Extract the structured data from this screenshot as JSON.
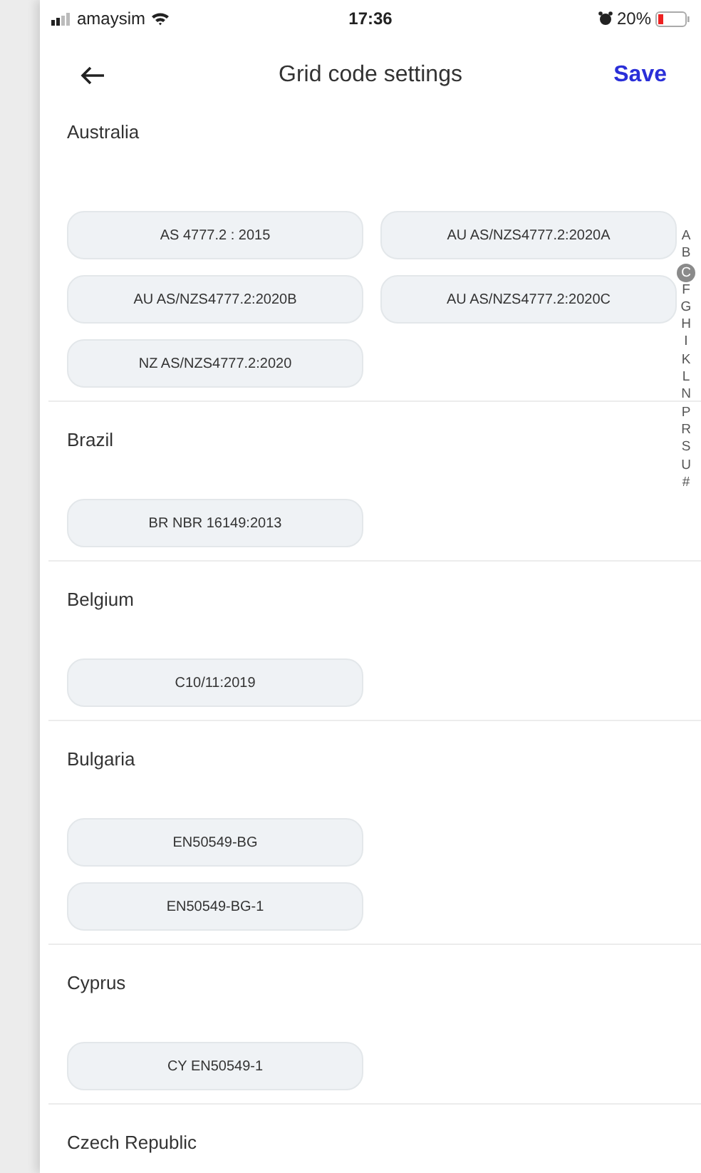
{
  "status_bar": {
    "carrier": "amaysim",
    "time": "17:36",
    "battery": "20%"
  },
  "header": {
    "title": "Grid code settings",
    "action": "Save"
  },
  "sections": [
    {
      "country": "Australia",
      "kind": "grid",
      "codes": [
        "AS 4777.2 : 2015",
        "AU AS/NZS4777.2:2020A",
        "AU AS/NZS4777.2:2020B",
        "AU AS/NZS4777.2:2020C",
        "NZ AS/NZS4777.2:2020"
      ]
    },
    {
      "country": "Brazil",
      "kind": "grid",
      "codes": [
        "BR NBR 16149:2013"
      ]
    },
    {
      "country": "Belgium",
      "kind": "grid",
      "codes": [
        "C10/11:2019"
      ]
    },
    {
      "country": "Bulgaria",
      "kind": "stacked",
      "codes": [
        "EN50549-BG",
        "EN50549-BG-1"
      ]
    },
    {
      "country": "Cyprus",
      "kind": "grid",
      "codes": [
        "CY EN50549-1"
      ]
    },
    {
      "country": "Czech Republic",
      "kind": "grid"
    }
  ],
  "index": [
    {
      "letter": "A",
      "selected": false
    },
    {
      "letter": "B",
      "selected": false
    },
    {
      "letter": "C",
      "selected": true
    },
    {
      "letter": "F",
      "selected": false
    },
    {
      "letter": "G",
      "selected": false
    },
    {
      "letter": "H",
      "selected": false
    },
    {
      "letter": "I",
      "selected": false
    },
    {
      "letter": "K",
      "selected": false
    },
    {
      "letter": "L",
      "selected": false
    },
    {
      "letter": "N",
      "selected": false
    },
    {
      "letter": "P",
      "selected": false
    },
    {
      "letter": "R",
      "selected": false
    },
    {
      "letter": "S",
      "selected": false
    },
    {
      "letter": "U",
      "selected": false
    },
    {
      "letter": "#",
      "selected": false
    }
  ]
}
